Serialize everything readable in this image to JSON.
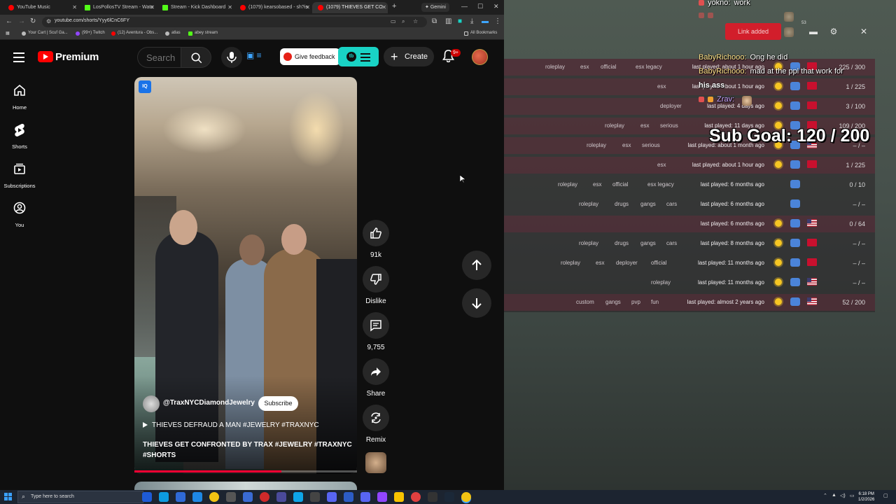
{
  "browser": {
    "tabs": [
      {
        "label": "YouTube Music",
        "color": "#ff0000"
      },
      {
        "label": "LosPollosTV Stream - Watc",
        "color": "#53fc18"
      },
      {
        "label": "Stream - Kick Dashboard",
        "color": "#53fc18"
      },
      {
        "label": "(1079) kearsobased - sh?is",
        "color": "#ff0000"
      },
      {
        "label": "(1079) THIEVES GET CO",
        "color": "#ff0000"
      }
    ],
    "gemini_label": "Gemini",
    "url": "youtube.com/shorts/Yyy6lCnC6FY",
    "bookmarks": [
      {
        "label": "Your Cart | Scuf Ga...",
        "color": "#bbbbbb"
      },
      {
        "label": "(99+) Twitch",
        "color": "#9146ff"
      },
      {
        "label": "(12) Aventura - Obs...",
        "color": "#ff0000"
      },
      {
        "label": "atlas",
        "color": "#bbbbbb"
      },
      {
        "label": "abey stream",
        "color": "#53fc18"
      }
    ],
    "all_bookmarks": "All Bookmarks"
  },
  "youtube": {
    "brand": "Premium",
    "search_placeholder": "Search",
    "feedback_label": "Give feedback",
    "create_label": "Create",
    "notif_badge": "9+",
    "sidebar": [
      {
        "label": "Home",
        "icon": "home-icon"
      },
      {
        "label": "Shorts",
        "icon": "shorts-icon"
      },
      {
        "label": "Subscriptions",
        "icon": "subscriptions-icon"
      },
      {
        "label": "You",
        "icon": "you-icon"
      }
    ],
    "short": {
      "badge": "IQ",
      "channel": "@TraxNYCDiamondJewelry",
      "subscribe": "Subscribe",
      "music": "THIEVES DEFRAUD A MAN #JEWELRY #TRAXNYC",
      "title": "THIEVES GET CONFRONTED BY TRAX #JEWELRY #TRAXNYC #SHORTS",
      "progress": 0.66
    },
    "actions": {
      "likes": "91k",
      "dislike": "Dislike",
      "comments": "9,755",
      "share": "Share",
      "remix": "Remix"
    }
  },
  "overlay": {
    "chat": [
      {
        "user": "yokno:",
        "msg": "work",
        "color": "#ffffff"
      },
      {
        "user": "BabyRichooo:",
        "msg": "Ong he did",
        "color": "#ffe28a"
      },
      {
        "user": "BabyRichooo:",
        "msg": "mad at the ppl that work for",
        "color": "#ffe28a"
      },
      {
        "user": "Zrav:",
        "msg": "",
        "color": "#c6a3ff"
      }
    ],
    "chat_wrap": "his ass",
    "sub_goal": "Sub Goal:  120 / 200",
    "small_count": "53",
    "redbtn_label": "Link added",
    "servers": [
      {
        "tags": [
          "roleplay",
          "esx",
          "official",
          "esx legacy"
        ],
        "played": "last played: about 1 hour ago",
        "count": "225 / 300",
        "flag": "red"
      },
      {
        "tags": [
          "esx"
        ],
        "played": "last played: about 1 hour ago",
        "count": "1 / 225",
        "flag": "red"
      },
      {
        "tags": [
          "deployer"
        ],
        "played": "last played: 4 days ago",
        "count": "3 / 100",
        "flag": "red"
      },
      {
        "tags": [
          "roleplay",
          "esx",
          "serious"
        ],
        "played": "last played: 11 days ago",
        "count": "109 / 200",
        "flag": "red"
      },
      {
        "tags": [
          "roleplay",
          "esx",
          "serious"
        ],
        "played": "last played: about 1 month ago",
        "count": "– / –",
        "flag": "us"
      },
      {
        "tags": [
          "esx"
        ],
        "played": "last played: about 1 hour ago",
        "count": "1 / 225",
        "flag": "red"
      },
      {
        "tags": [
          "roleplay",
          "esx",
          "official",
          "esx legacy"
        ],
        "played": "last played: 6 months ago",
        "count": "0 / 10",
        "flag": ""
      },
      {
        "tags": [
          "roleplay",
          "drugs",
          "gangs",
          "cars"
        ],
        "played": "last played: 6 months ago",
        "count": "– / –",
        "flag": ""
      },
      {
        "tags": [],
        "played": "last played: 6 months ago",
        "count": "0 / 64",
        "flag": "us"
      },
      {
        "tags": [
          "roleplay",
          "drugs",
          "gangs",
          "cars"
        ],
        "played": "last played: 8 months ago",
        "count": "– / –",
        "flag": "red"
      },
      {
        "tags": [
          "roleplay",
          "esx",
          "deployer",
          "official"
        ],
        "played": "last played: 11 months ago",
        "count": "– / –",
        "flag": "red"
      },
      {
        "tags": [
          "roleplay"
        ],
        "played": "last played: 11 months ago",
        "count": "– / –",
        "flag": "us"
      },
      {
        "tags": [
          "custom",
          "gangs",
          "pvp",
          "fun"
        ],
        "played": "last played: almost 2 years ago",
        "count": "52 / 200",
        "flag": "us"
      }
    ]
  },
  "taskbar": {
    "search_placeholder": "Type here to search",
    "time": "6:18 PM",
    "date": "1/2/2026"
  }
}
